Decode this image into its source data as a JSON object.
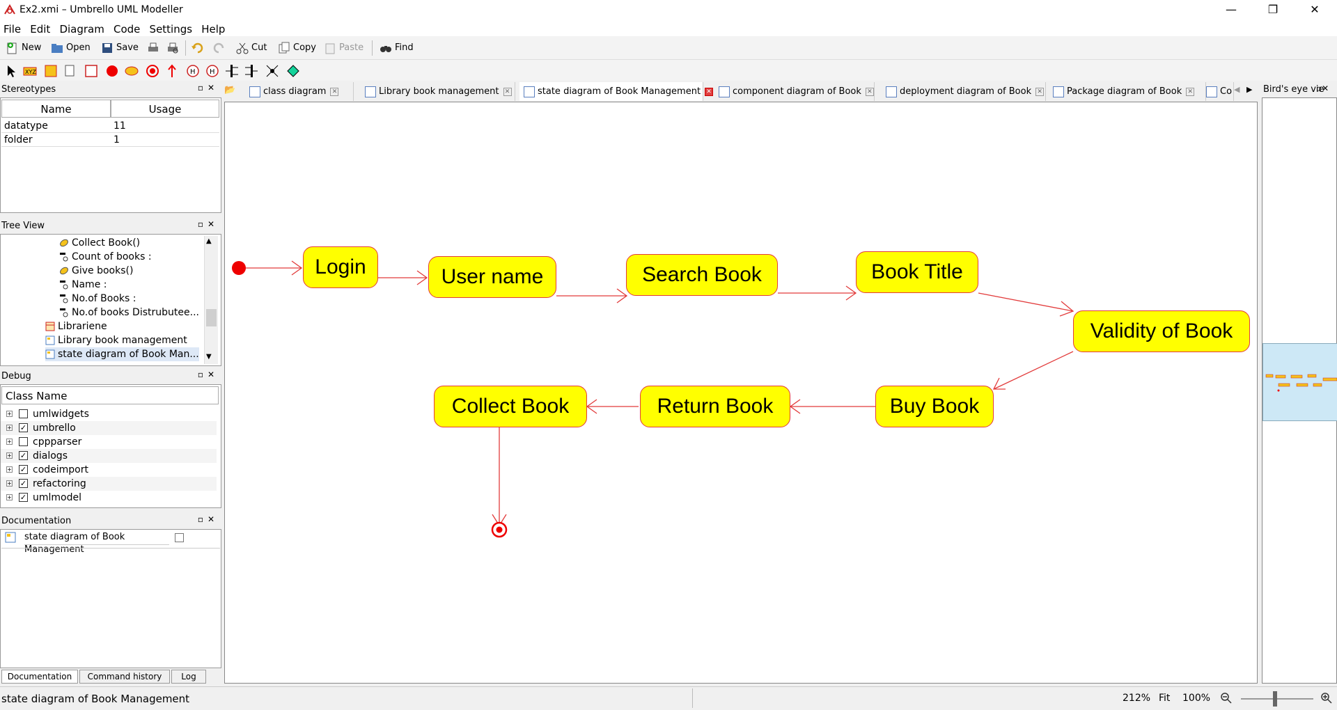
{
  "window": {
    "title": "Ex2.xmi – Umbrello UML Modeller",
    "minimize": "—",
    "maximize": "❐",
    "close": "✕"
  },
  "menu": [
    "File",
    "Edit",
    "Diagram",
    "Code",
    "Settings",
    "Help"
  ],
  "toolbar": {
    "new": "New",
    "open": "Open",
    "save": "Save",
    "cut": "Cut",
    "copy": "Copy",
    "paste": "Paste",
    "find": "Find"
  },
  "stereotypes": {
    "title": "Stereotypes",
    "columns": [
      "Name",
      "Usage"
    ],
    "rows": [
      {
        "name": "datatype",
        "usage": "11"
      },
      {
        "name": "folder",
        "usage": "1"
      }
    ]
  },
  "tree": {
    "title": "Tree View",
    "items": [
      {
        "label": "Collect Book()",
        "icon": "operation-icon"
      },
      {
        "label": "Count of books :",
        "icon": "attribute-icon"
      },
      {
        "label": "Give books()",
        "icon": "operation-icon"
      },
      {
        "label": "Name :",
        "icon": "attribute-icon"
      },
      {
        "label": "No.of Books :",
        "icon": "attribute-icon"
      },
      {
        "label": "No.of books Distrubutee...",
        "icon": "attribute-icon"
      },
      {
        "label": "Librariene",
        "icon": "class-icon"
      },
      {
        "label": "Library book management",
        "icon": "diagram-icon"
      },
      {
        "label": "state diagram of Book Man...",
        "icon": "diagram-icon"
      }
    ]
  },
  "debug": {
    "title": "Debug",
    "column": "Class Name",
    "rows": [
      {
        "name": "umlwidgets",
        "checked": false
      },
      {
        "name": "umbrello",
        "checked": true
      },
      {
        "name": "cppparser",
        "checked": false
      },
      {
        "name": "dialogs",
        "checked": true
      },
      {
        "name": "codeimport",
        "checked": true
      },
      {
        "name": "refactoring",
        "checked": true
      },
      {
        "name": "umlmodel",
        "checked": true
      }
    ]
  },
  "documentation": {
    "title": "Documentation",
    "field": "state diagram of Book Management",
    "tabs": [
      "Documentation",
      "Command history",
      "Log"
    ]
  },
  "tabs": [
    {
      "label": "class diagram",
      "active": false
    },
    {
      "label": "Library book management",
      "active": false
    },
    {
      "label": "state diagram of Book Management",
      "active": true
    },
    {
      "label": "component diagram of Book",
      "active": false
    },
    {
      "label": "deployment diagram of Book",
      "active": false
    },
    {
      "label": "Package diagram of Book",
      "active": false
    },
    {
      "label": "Co",
      "active": false
    }
  ],
  "diagram": {
    "states": [
      "Login",
      "User name",
      "Search Book",
      "Book Title",
      "Validity of Book",
      "Buy Book",
      "Return Book",
      "Collect Book"
    ],
    "colors": {
      "fill": "#ffff00",
      "border": "#e23b3b",
      "arrow": "#e23b3b"
    }
  },
  "birdseye": {
    "title": "Bird's eye vie"
  },
  "status": {
    "message": "state diagram of Book Management",
    "zoom": "212%",
    "fit": "Fit",
    "hundred": "100%"
  }
}
